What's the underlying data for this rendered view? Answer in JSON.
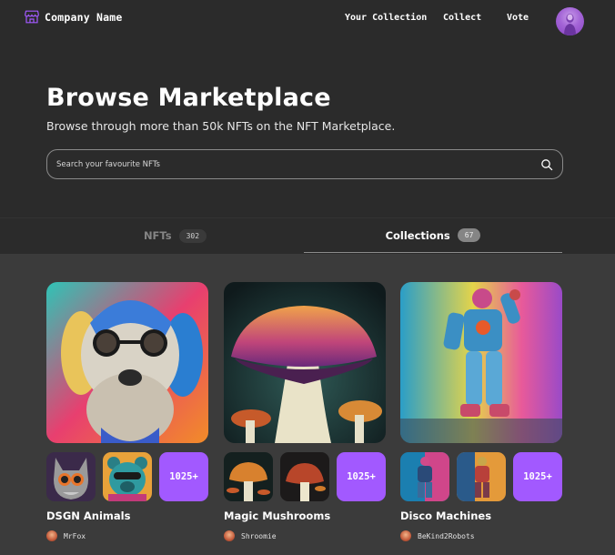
{
  "brand": {
    "name": "Company Name",
    "icon": "storefront-icon",
    "accent": "#a259ff"
  },
  "nav": {
    "links": [
      "Your Collection",
      "Collect",
      "Vote"
    ]
  },
  "hero": {
    "title": "Browse Marketplace",
    "subtitle": "Browse through more than 50k NFTs on the NFT Marketplace.",
    "search_placeholder": "Search your favourite NFTs"
  },
  "tabs": [
    {
      "label": "NFTs",
      "count": "302",
      "active": false
    },
    {
      "label": "Collections",
      "count": "67",
      "active": true
    }
  ],
  "collections": [
    {
      "title": "DSGN Animals",
      "creator": "MrFox",
      "more": "1025+"
    },
    {
      "title": "Magic Mushrooms",
      "creator": "Shroomie",
      "more": "1025+"
    },
    {
      "title": "Disco Machines",
      "creator": "BeKind2Robots",
      "more": "1025+"
    }
  ],
  "colors": {
    "background": "#2b2b2b",
    "content_background": "#3b3b3b",
    "accent": "#a259ff",
    "muted": "#858585"
  }
}
